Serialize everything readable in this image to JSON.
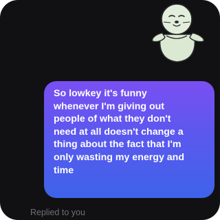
{
  "message": {
    "text": "So lowkey it's funny\nwhenever I'm giving out\npeople of what they don't\nneed at all doesn't change a\nthing about the fact that I'm\nonly wasting my energy and\ntime",
    "bubble_color_top": "#7a4ff2",
    "bubble_color_bottom": "#3e63ea"
  },
  "sticker": {
    "icon": "seal-sticker-icon"
  },
  "reply_label": "Replied to you"
}
